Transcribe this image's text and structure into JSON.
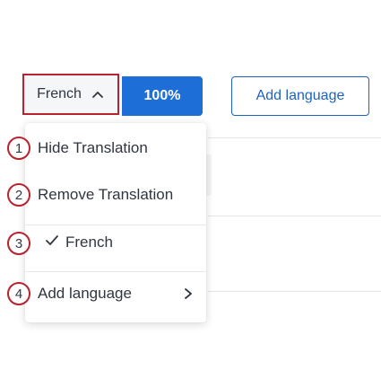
{
  "toolbar": {
    "language_select_label": "French",
    "progress_label": "100%",
    "add_language_label": "Add language"
  },
  "menu": {
    "items": [
      {
        "label": "Hide Translation",
        "marker": "1"
      },
      {
        "label": "Remove Translation",
        "marker": "2"
      },
      {
        "label": "French",
        "marker": "3",
        "checked": true
      },
      {
        "label": "Add language",
        "marker": "4",
        "has_submenu": true
      }
    ]
  },
  "colors": {
    "accent": "#1e6ed7",
    "highlight_border": "#b8232f",
    "text": "#2f3640"
  },
  "icons": {
    "select_chevron": "chevron-up-icon",
    "checked_item": "checkmark-icon",
    "submenu": "chevron-right-icon"
  }
}
